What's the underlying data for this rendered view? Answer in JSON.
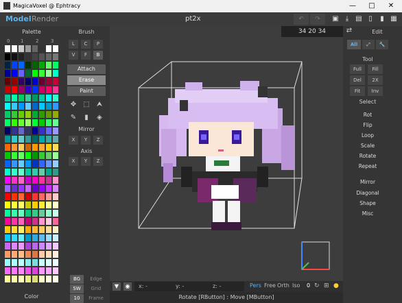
{
  "window": {
    "title": "MagicaVoxel @ Ephtracy",
    "minimize": "—",
    "maximize": "□",
    "close": "✕"
  },
  "menu": {
    "model_tab": "Model",
    "render_tab": "Render",
    "filename": "pt2x"
  },
  "toolbar_icons": {
    "undo": "↶",
    "redo": "↷",
    "save": "💾",
    "export": "⇩",
    "open": "📂",
    "new": "📄",
    "copy": "📄",
    "delete": "🗑"
  },
  "palette": {
    "title": "Palette",
    "page_labels": [
      "0",
      "1",
      "2",
      "3"
    ],
    "footer": "Color",
    "rows": [
      [
        "#ffffff",
        "#ffffff",
        "#cccccc",
        "#999999",
        "#666666",
        "#333333",
        "#ffffff",
        "#ffffff"
      ],
      [
        "#000000",
        "#111111",
        "#222222",
        "#333333",
        "#444444",
        "#555555",
        "#666666",
        "#777777"
      ],
      [
        "#002244",
        "#0044ff",
        "#0066ff",
        "#003300",
        "#006600",
        "#00aa00",
        "#66ff66",
        "#00ff66"
      ],
      [
        "#000099",
        "#0000ff",
        "#6666ff",
        "#006633",
        "#00ff00",
        "#33ff33",
        "#99ff99",
        "#00ffcc"
      ],
      [
        "#660000",
        "#990000",
        "#330066",
        "#000066",
        "#0000cc",
        "#660033",
        "#990033",
        "#cc0033"
      ],
      [
        "#cc0000",
        "#ff0000",
        "#990066",
        "#3300cc",
        "#0033ff",
        "#cc0066",
        "#ff0066",
        "#ff3399"
      ],
      [
        "#00cc99",
        "#00ffaa",
        "#00cc66",
        "#33cc99",
        "#009966",
        "#00ccaa",
        "#00ffff",
        "#33ffcc"
      ],
      [
        "#00ffff",
        "#33ccff",
        "#0099ff",
        "#66ccff",
        "#0066cc",
        "#00ccff",
        "#0099cc",
        "#3399ff"
      ],
      [
        "#00cc66",
        "#33cc33",
        "#66cc00",
        "#99cc00",
        "#00aa33",
        "#339900",
        "#669900",
        "#99aa00"
      ],
      [
        "#00ff66",
        "#33ff00",
        "#66ff33",
        "#99ff66",
        "#00ff33",
        "#00cc00",
        "#33ff66",
        "#66ff99"
      ],
      [
        "#000066",
        "#333399",
        "#6666cc",
        "#333366",
        "#000099",
        "#3333cc",
        "#6666ff",
        "#9999ff"
      ],
      [
        "#009999",
        "#33cccc",
        "#66cccc",
        "#339999",
        "#006666",
        "#00aaaa",
        "#33aaaa",
        "#66aaaa"
      ],
      [
        "#ff6600",
        "#ff9933",
        "#ffcc66",
        "#cc6600",
        "#ff9900",
        "#ffaa33",
        "#ffcc00",
        "#ffdd55"
      ],
      [
        "#00cc00",
        "#33ff33",
        "#66ff66",
        "#00ff00",
        "#009900",
        "#33cc33",
        "#66cc66",
        "#99ff99"
      ],
      [
        "#0066ff",
        "#3399ff",
        "#66ccff",
        "#0099ff",
        "#0033cc",
        "#3366ff",
        "#6699ff",
        "#99ccff"
      ],
      [
        "#00ffcc",
        "#33ffcc",
        "#66ffcc",
        "#00ccaa",
        "#33ccaa",
        "#66ccaa",
        "#00aa88",
        "#339988"
      ],
      [
        "#ff00ff",
        "#ff33cc",
        "#ff66cc",
        "#cc00cc",
        "#ff00cc",
        "#ff3399",
        "#cc3399",
        "#ff99cc"
      ],
      [
        "#9966ff",
        "#6633cc",
        "#9933ff",
        "#cc66ff",
        "#6600cc",
        "#9900ff",
        "#cc33ff",
        "#dd88ff"
      ],
      [
        "#ff0000",
        "#ff3300",
        "#ff6633",
        "#cc0000",
        "#ff3333",
        "#ff6666",
        "#ff9999",
        "#ffcccc"
      ],
      [
        "#ffff00",
        "#ffff33",
        "#ffff66",
        "#cccc00",
        "#ffcc00",
        "#ffee33",
        "#ffff99",
        "#ffffcc"
      ],
      [
        "#00ff99",
        "#33ffaa",
        "#66ffbb",
        "#00cc77",
        "#33cc88",
        "#66cc99",
        "#99ffcc",
        "#ccffee"
      ],
      [
        "#ff0099",
        "#ff33aa",
        "#ff66bb",
        "#cc0077",
        "#cc3388",
        "#ff99cc",
        "#ffcce5",
        "#ff6699"
      ],
      [
        "#ffcc00",
        "#ffdd33",
        "#ffee66",
        "#ffaa00",
        "#ffbb33",
        "#ffcc66",
        "#ffdd99",
        "#ffeecc"
      ],
      [
        "#00ccff",
        "#33ddff",
        "#66eeff",
        "#0099cc",
        "#33aadd",
        "#66bbee",
        "#99ddff",
        "#ccf0ff"
      ],
      [
        "#cc66ff",
        "#dd88ff",
        "#ee99ff",
        "#aa44dd",
        "#bb66ee",
        "#cc88ff",
        "#ddaaff",
        "#eeccff"
      ],
      [
        "#ff9966",
        "#ffaa77",
        "#ffbb88",
        "#ee8855",
        "#dd7744",
        "#ffccaa",
        "#ffddbb",
        "#ffeedd"
      ],
      [
        "#99ffff",
        "#aaffff",
        "#bbffff",
        "#88eeee",
        "#77dddd",
        "#ccffff",
        "#ddffff",
        "#eeffff"
      ],
      [
        "#ff66ff",
        "#ff77ff",
        "#ff88ff",
        "#ee55ee",
        "#dd44dd",
        "#ff99ff",
        "#ffaaff",
        "#ffccff"
      ],
      [
        "#ffff99",
        "#ffffaa",
        "#ffffbb",
        "#eeee88",
        "#dddd77",
        "#ffffcc",
        "#ffffdd",
        "#ffffee"
      ]
    ]
  },
  "brush": {
    "title": "Brush",
    "modes_row1": [
      "L",
      "C",
      "P"
    ],
    "modes_row2": [
      "V",
      "F",
      "B"
    ],
    "actions": [
      "Attach",
      "Erase",
      "Paint"
    ],
    "mirror_label": "Mirror",
    "axis_label": "Axis",
    "xyz": [
      "X",
      "Y",
      "Z"
    ],
    "footer_left": [
      "BG",
      "SW",
      "10"
    ],
    "footer_right": [
      "Edge",
      "Grid",
      "Frame"
    ]
  },
  "viewport": {
    "coords": "34 20 34",
    "x_label": "x: -",
    "y_label": "y: -",
    "z_label": "z: -",
    "view_modes": [
      "Pers",
      "Free",
      "Orth",
      "Iso"
    ],
    "zero": "0",
    "status": "Rotate [RButton] : Move [MButton]"
  },
  "edit": {
    "title": "Edit",
    "filter_all": "All",
    "tool_label": "Tool",
    "tool_buttons": [
      [
        "Full",
        "Fill"
      ],
      [
        "Del",
        "2X"
      ],
      [
        "Fit",
        "Inv"
      ]
    ],
    "select_label": "Select",
    "operations": [
      "Rot",
      "Flip",
      "Loop",
      "Scale",
      "Rotate",
      "Repeat"
    ],
    "more": [
      "Mirror",
      "Diagonal",
      "Shape",
      "Misc"
    ]
  },
  "colors": {
    "accent": "#5fb3e8",
    "panel": "#353535",
    "viewport": "#3d3d3d"
  }
}
